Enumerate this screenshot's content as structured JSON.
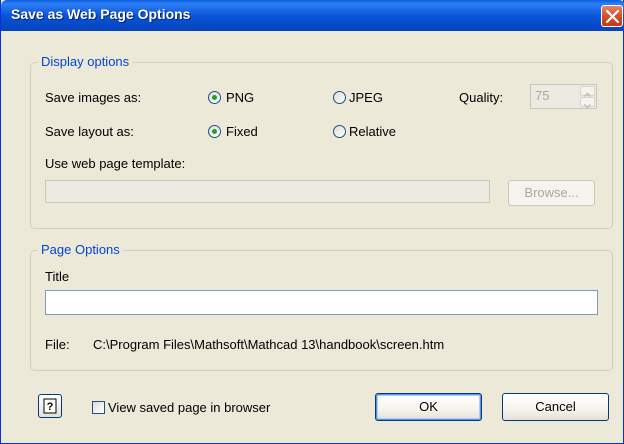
{
  "window": {
    "title": "Save as Web Page Options"
  },
  "display_options": {
    "legend": "Display options",
    "save_images_label": "Save images as:",
    "png_label": "PNG",
    "jpeg_label": "JPEG",
    "images_selected": "PNG",
    "quality_label": "Quality:",
    "quality_value": "75",
    "save_layout_label": "Save layout as:",
    "fixed_label": "Fixed",
    "relative_label": "Relative",
    "layout_selected": "Fixed",
    "template_label": "Use web page template:",
    "template_value": "",
    "browse_label": "Browse..."
  },
  "page_options": {
    "legend": "Page Options",
    "title_label": "Title",
    "title_value": "",
    "file_label": "File:",
    "file_value": "C:\\Program Files\\Mathsoft\\Mathcad 13\\handbook\\screen.htm"
  },
  "footer": {
    "help_glyph": "?",
    "view_in_browser_label": "View saved page in browser",
    "view_in_browser_checked": false,
    "ok_label": "OK",
    "cancel_label": "Cancel"
  },
  "colors": {
    "titlebar": "#0a55d8",
    "group_legend": "#0046d5",
    "radio_dot": "#21a121",
    "dialog_bg": "#ece9d8"
  }
}
